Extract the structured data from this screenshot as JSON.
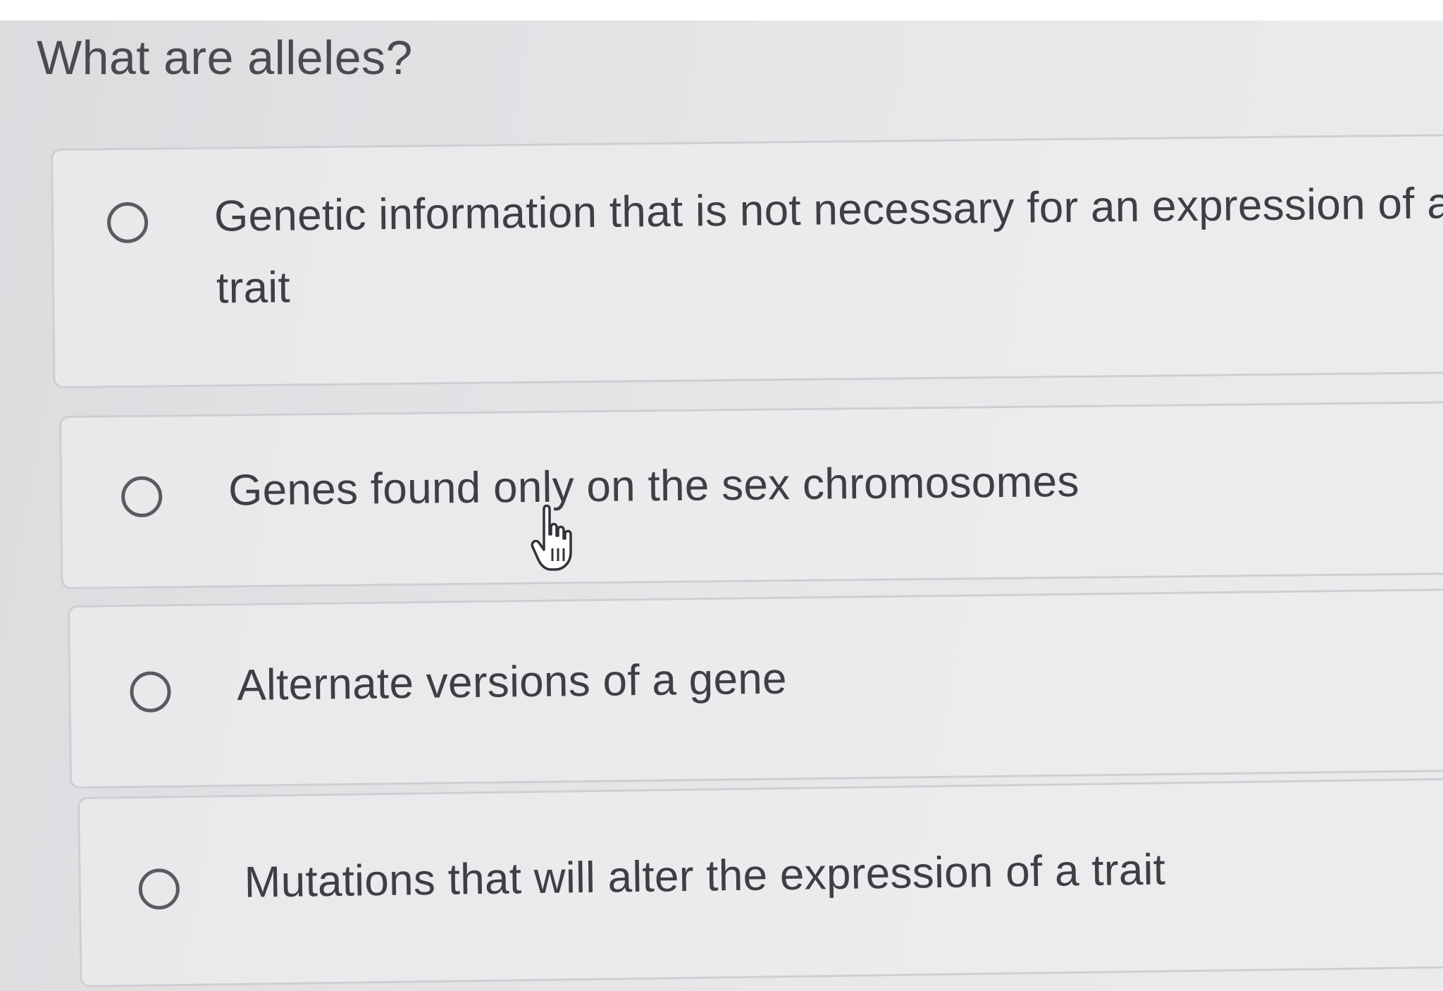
{
  "question": {
    "title": "What are alleles?"
  },
  "options": [
    {
      "line1": "Genetic information that is not necessary for an expression of a",
      "line2": "trait",
      "selected": false
    },
    {
      "line1": "Genes found only on the sex chromosomes",
      "selected": false
    },
    {
      "line1": "Alternate versions of a gene",
      "selected": false
    },
    {
      "line1": "Mutations that will alter the expression of a trait",
      "selected": false
    }
  ],
  "cursor": {
    "icon": "hand-pointer-icon"
  },
  "colors": {
    "background": "#e5e5e8",
    "text": "#3e3e43",
    "card_border": "#cfcfd3",
    "radio_ring": "#5a5a5f"
  }
}
